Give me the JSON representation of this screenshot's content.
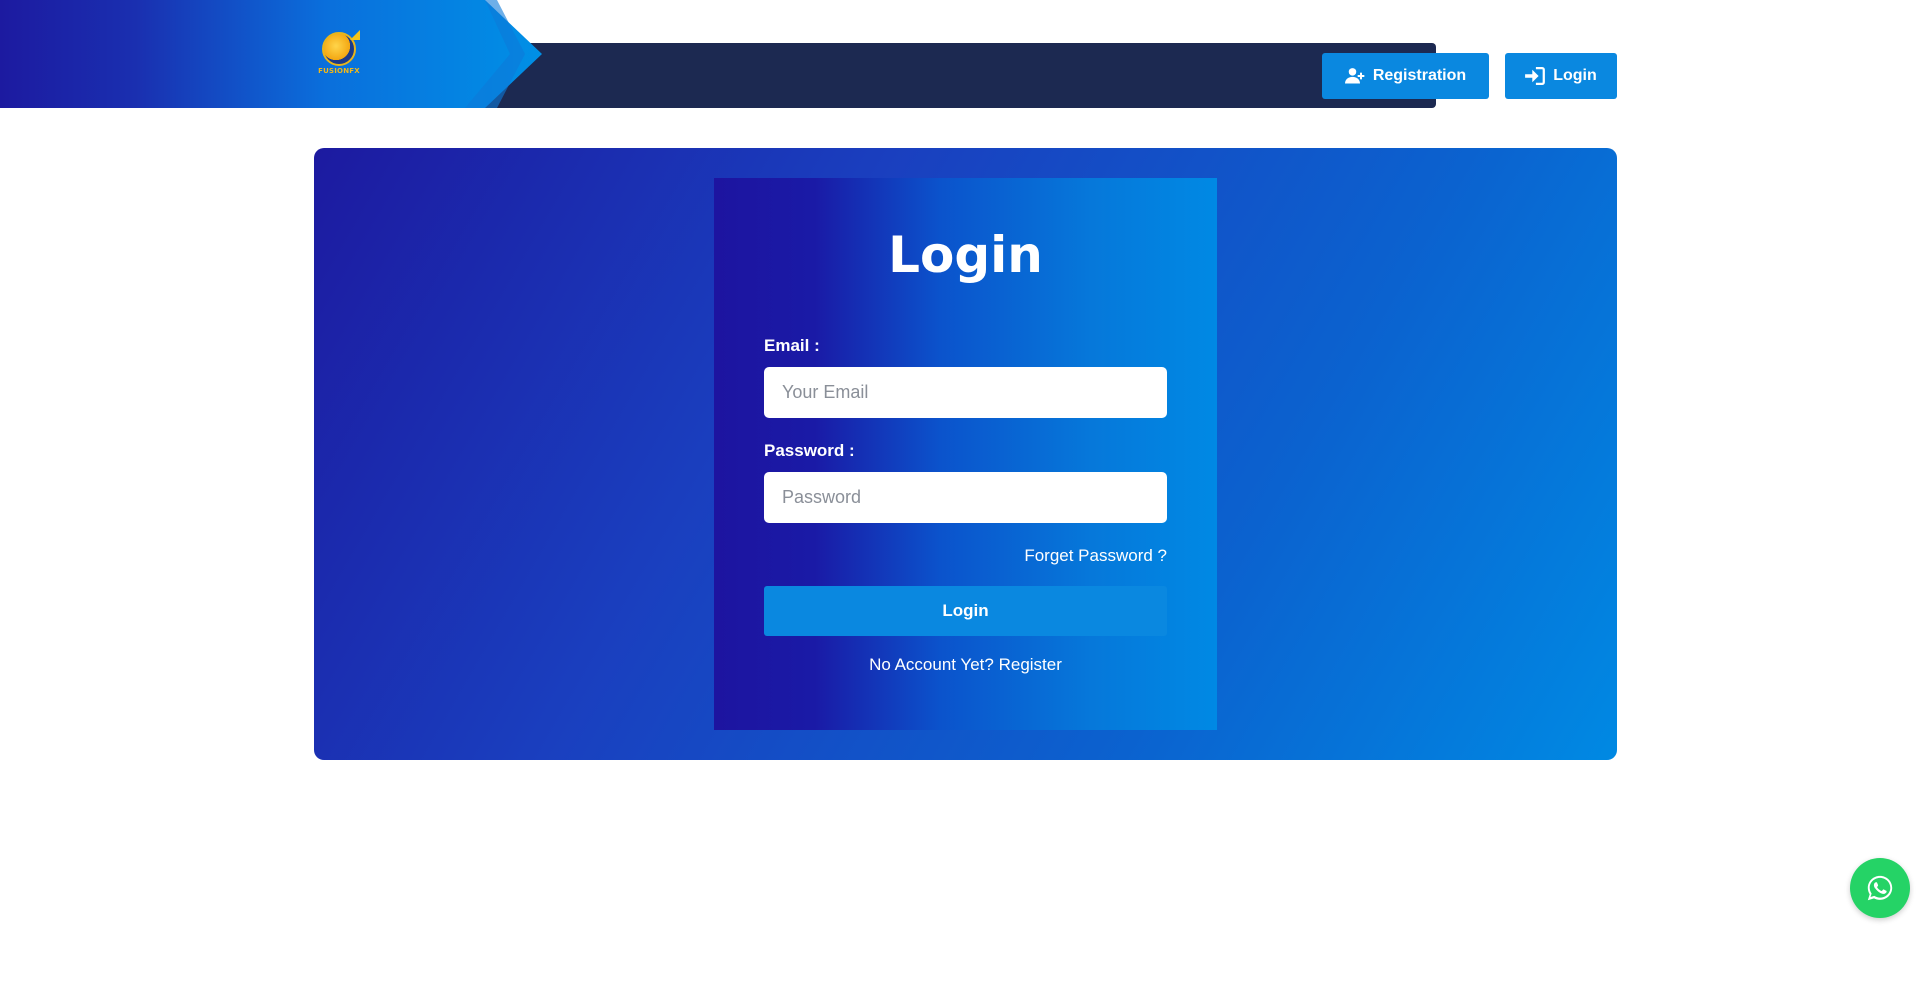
{
  "brand": {
    "logo_text": "FUSIONFX"
  },
  "header": {
    "registration_label": "Registration",
    "login_label": "Login"
  },
  "login_form": {
    "title": "Login",
    "email_label": "Email :",
    "email_placeholder": "Your Email",
    "email_value": "",
    "password_label": "Password :",
    "password_placeholder": "Password",
    "password_value": "",
    "forget_password_label": "Forget Password ?",
    "submit_label": "Login",
    "no_account_text": "No Account Yet?",
    "register_link_label": "Register"
  },
  "icons": {
    "registration": "user-plus-icon",
    "login": "sign-in-icon",
    "whatsapp": "whatsapp-icon"
  },
  "colors": {
    "header_dark": "#1c2951",
    "primary_button": "#0a88e0",
    "panel_gradient_start": "#1c1aa0",
    "panel_gradient_end": "#0089e3",
    "whatsapp": "#25d366"
  }
}
